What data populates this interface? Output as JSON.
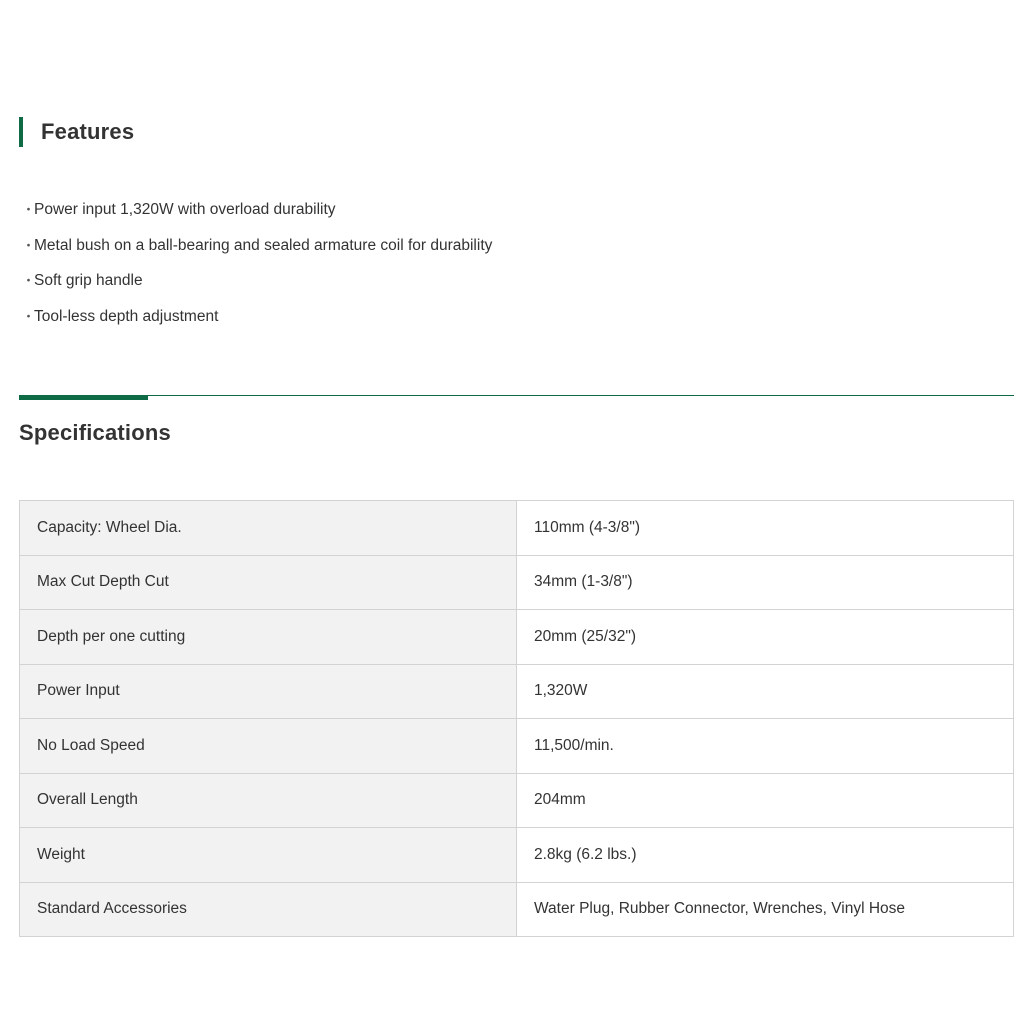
{
  "features": {
    "title": "Features",
    "bullet": "・",
    "items": [
      "Power input 1,320W with overload durability",
      "Metal bush on a ball-bearing and sealed armature coil for durability",
      "Soft grip handle",
      "Tool-less depth adjustment"
    ]
  },
  "specifications": {
    "title": "Specifications",
    "rows": [
      {
        "label": "Capacity: Wheel Dia.",
        "value": "110mm (4-3/8\")"
      },
      {
        "label": "Max Cut Depth Cut",
        "value": "34mm (1-3/8\")"
      },
      {
        "label": "Depth per one cutting",
        "value": "20mm (25/32\")"
      },
      {
        "label": "Power Input",
        "value": "1,320W"
      },
      {
        "label": "No Load Speed",
        "value": "11,500/min."
      },
      {
        "label": "Overall Length",
        "value": "204mm"
      },
      {
        "label": "Weight",
        "value": "2.8kg (6.2 lbs.)"
      },
      {
        "label": "Standard Accessories",
        "value": "Water Plug, Rubber Connector, Wrenches, Vinyl Hose"
      }
    ]
  },
  "colors": {
    "accent": "#0f6b45",
    "table_border": "#d3d3d3",
    "label_cell_bg": "#f2f2f2",
    "text": "#333333"
  }
}
